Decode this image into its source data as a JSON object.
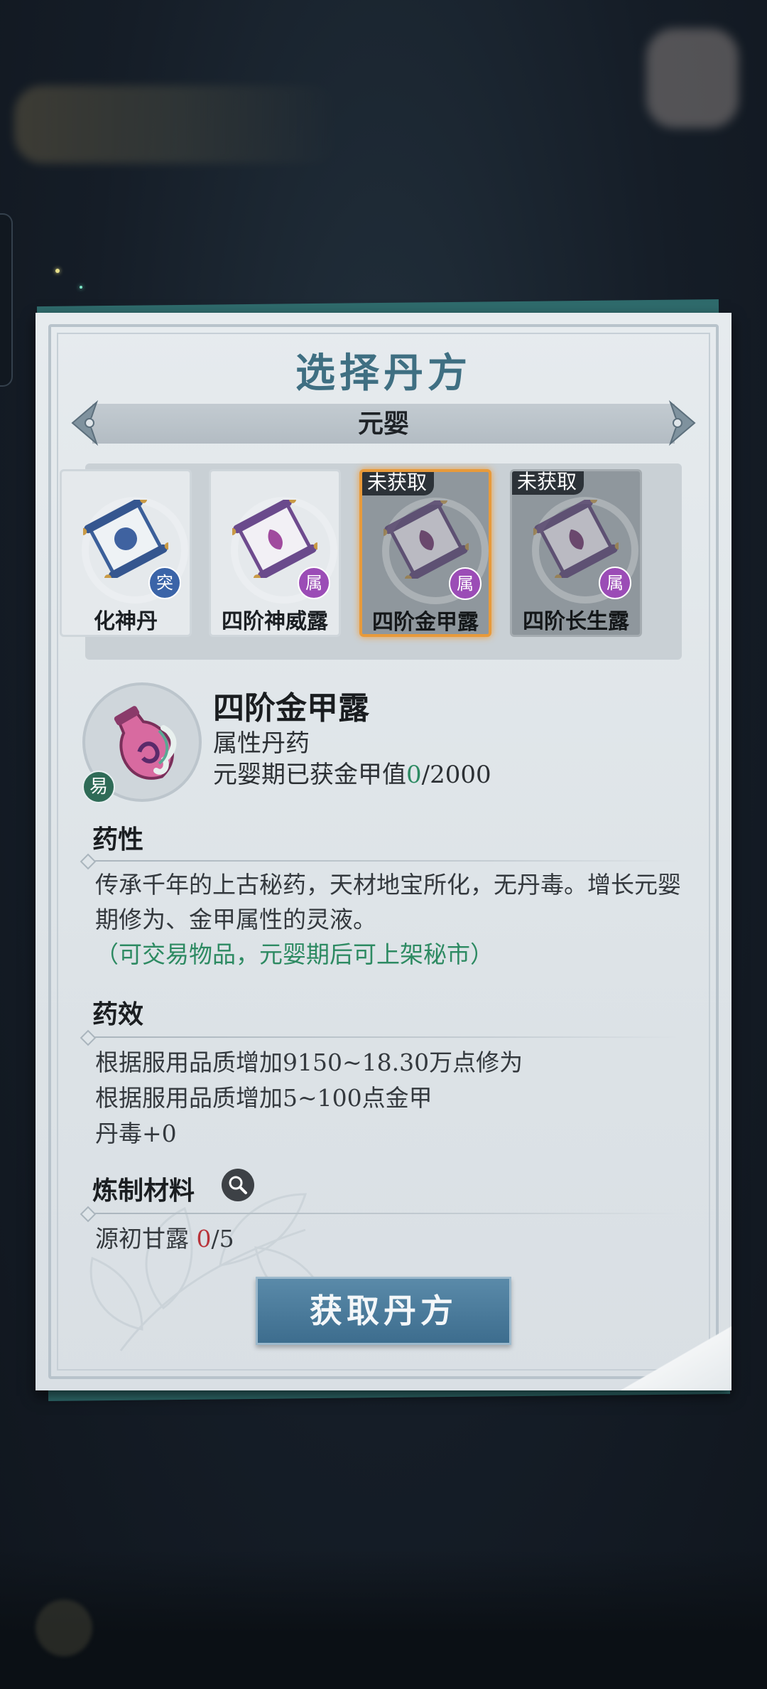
{
  "dialog": {
    "title": "选择丹方",
    "stage": "元婴"
  },
  "recipes": [
    {
      "name": "化神丹",
      "badge": "突",
      "badge_color": "#3b64a8",
      "locked": false,
      "lock_label": ""
    },
    {
      "name": "四阶神威露",
      "badge": "属",
      "badge_color": "#9b4cb6",
      "locked": false,
      "lock_label": ""
    },
    {
      "name": "四阶金甲露",
      "badge": "属",
      "badge_color": "#9b4cb6",
      "locked": true,
      "lock_label": "未获取",
      "selected": true
    },
    {
      "name": "四阶长生露",
      "badge": "属",
      "badge_color": "#9b4cb6",
      "locked": true,
      "lock_label": "未获取"
    }
  ],
  "detail": {
    "name": "四阶金甲露",
    "type": "属性丹药",
    "progress_label": "元婴期已获金甲值",
    "progress_current": "0",
    "progress_total": "/2000",
    "easy_badge": "易",
    "icon": "pink-gourd-icon"
  },
  "sections": {
    "properties": {
      "heading": "药性",
      "text": "传承千年的上古秘药，天材地宝所化，无丹毒。增长元婴期修为、金甲属性的灵液。",
      "note": "（可交易物品，元婴期后可上架秘市）"
    },
    "effects": {
      "heading": "药效",
      "lines": [
        "根据服用品质增加9150~18.30万点修为",
        "根据服用品质增加5~100点金甲",
        "丹毒+0"
      ]
    },
    "materials": {
      "heading": "炼制材料",
      "item_name": "源初甘露",
      "item_have": "0",
      "item_need": "/5"
    }
  },
  "action_button": "获取丹方",
  "colors": {
    "accent_green": "#2d8a62",
    "accent_red": "#b8333a",
    "title_blue": "#3f6f82",
    "selected_border": "#e89a3a"
  }
}
